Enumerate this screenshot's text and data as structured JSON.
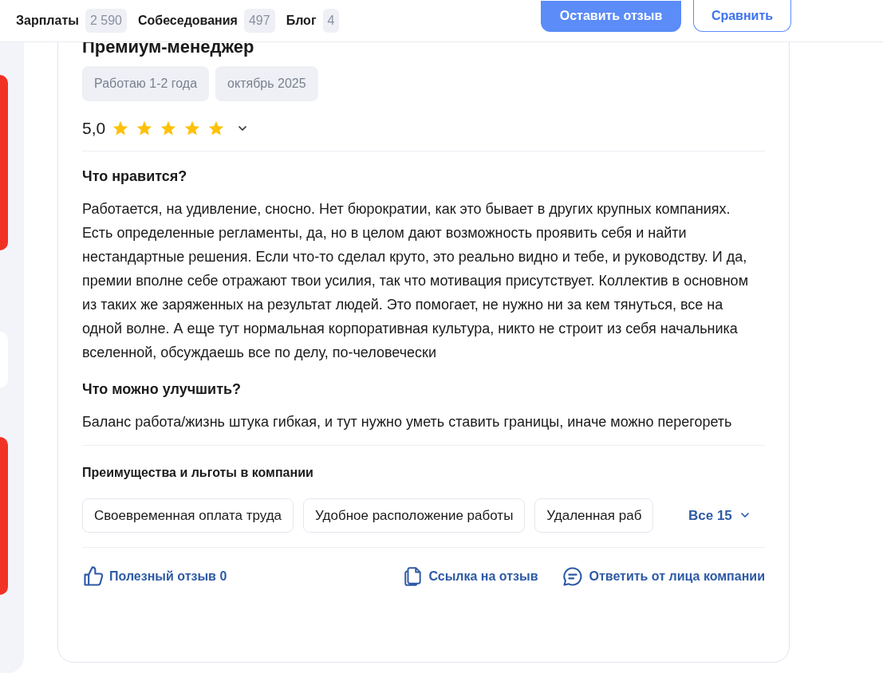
{
  "nav": [
    {
      "label": "Зарплаты",
      "count": "2 590"
    },
    {
      "label": "Собеседования",
      "count": "497"
    },
    {
      "label": "Блог",
      "count": "4"
    }
  ],
  "actions": {
    "primary": "Оставить отзыв",
    "secondary": "Сравнить"
  },
  "review": {
    "title": "Премиум-менеджер",
    "tags": [
      "Работаю 1-2 года",
      "октябрь 2025"
    ],
    "rating": "5,0",
    "stars": 5,
    "sections": [
      {
        "heading": "Что нравится?",
        "text": "Работается, на удивление, сносно. Нет бюрократии, как это бывает в других крупных компаниях. Есть определенные регламенты, да, но в целом дают возможность проявить себя и найти нестандартные решения. Если что-то сделал круто, это реально видно и тебе, и руководству. И да, премии вполне себе отражают твои усилия, так что мотивация присутствует. Коллектив в основном из таких же заряженных на результат людей. Это помогает, не нужно ни за кем тянуться, все на одной волне. А еще тут нормальная корпоративная культура, никто не строит из себя начальника вселенной, обсуждаешь все по делу, по-человечески"
      },
      {
        "heading": "Что можно улучшить?",
        "text": "Баланс работа/жизнь штука гибкая, и тут нужно уметь ставить границы, иначе можно перегореть"
      }
    ],
    "benefits": {
      "title": "Преимущества и льготы в компании",
      "items": [
        "Своевременная оплата труда",
        "Удобное расположение работы",
        "Удаленная раб"
      ],
      "more": "Все 15"
    },
    "footer": [
      {
        "kind": "like",
        "label": "Полезный отзыв 0"
      },
      {
        "kind": "link",
        "label": "Ссылка на отзыв"
      },
      {
        "kind": "reply",
        "label": "Ответить от лица компании"
      }
    ]
  }
}
